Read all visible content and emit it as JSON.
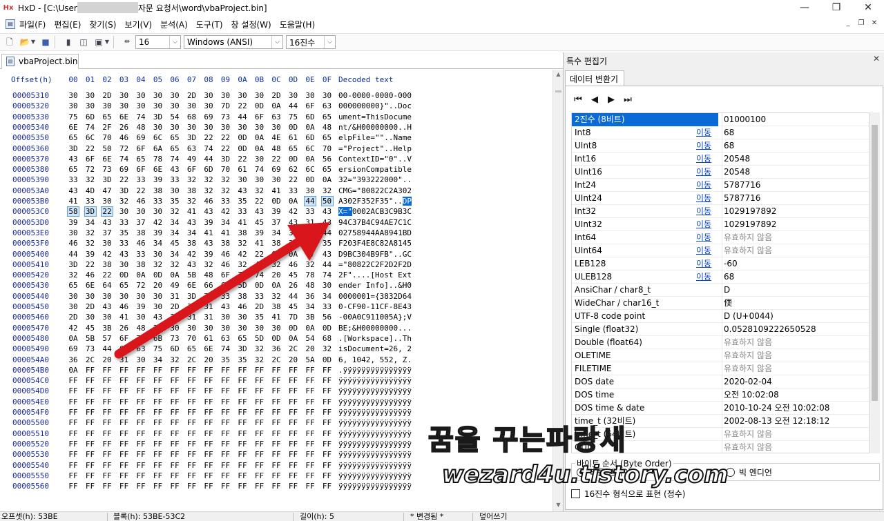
{
  "window": {
    "logo": "Hx",
    "title_prefix": "HxD - [C:\\User",
    "title_suffix": "자문 요청서\\word\\vbaProject.bin]",
    "minimize": "—",
    "restore": "❐",
    "close": "✕"
  },
  "menu": {
    "items": [
      "파일(F)",
      "편집(E)",
      "찾기(S)",
      "보기(V)",
      "분석(A)",
      "도구(T)",
      "창 설정(W)",
      "도움말(H)"
    ],
    "mdi": [
      "_",
      "❐",
      "✕"
    ]
  },
  "toolbar": {
    "bytes_per_row": "16",
    "charset": "Windows (ANSI)",
    "base": "16진수"
  },
  "document_tab": "vbaProject.bin",
  "hex": {
    "offset_header": "Offset(h)",
    "columns": [
      "00",
      "01",
      "02",
      "03",
      "04",
      "05",
      "06",
      "07",
      "08",
      "09",
      "0A",
      "0B",
      "0C",
      "0D",
      "0E",
      "0F"
    ],
    "decoded_header": "Decoded text",
    "rows": [
      {
        "offset": "00005310",
        "bytes": [
          "30",
          "30",
          "2D",
          "30",
          "30",
          "30",
          "30",
          "2D",
          "30",
          "30",
          "30",
          "30",
          "2D",
          "30",
          "30",
          "30"
        ],
        "text": "00-0000-0000-000"
      },
      {
        "offset": "00005320",
        "bytes": [
          "30",
          "30",
          "30",
          "30",
          "30",
          "30",
          "30",
          "30",
          "30",
          "7D",
          "22",
          "0D",
          "0A",
          "44",
          "6F",
          "63"
        ],
        "text": "000000000}\"..Doc"
      },
      {
        "offset": "00005330",
        "bytes": [
          "75",
          "6D",
          "65",
          "6E",
          "74",
          "3D",
          "54",
          "68",
          "69",
          "73",
          "44",
          "6F",
          "63",
          "75",
          "6D",
          "65"
        ],
        "text": "ument=ThisDocume"
      },
      {
        "offset": "00005340",
        "bytes": [
          "6E",
          "74",
          "2F",
          "26",
          "48",
          "30",
          "30",
          "30",
          "30",
          "30",
          "30",
          "30",
          "30",
          "0D",
          "0A",
          "48"
        ],
        "text": "nt/&H00000000..H"
      },
      {
        "offset": "00005350",
        "bytes": [
          "65",
          "6C",
          "70",
          "46",
          "69",
          "6C",
          "65",
          "3D",
          "22",
          "22",
          "0D",
          "0A",
          "4E",
          "61",
          "6D",
          "65"
        ],
        "text": "elpFile=\"\"..Name"
      },
      {
        "offset": "00005360",
        "bytes": [
          "3D",
          "22",
          "50",
          "72",
          "6F",
          "6A",
          "65",
          "63",
          "74",
          "22",
          "0D",
          "0A",
          "48",
          "65",
          "6C",
          "70"
        ],
        "text": "=\"Project\"..Help"
      },
      {
        "offset": "00005370",
        "bytes": [
          "43",
          "6F",
          "6E",
          "74",
          "65",
          "78",
          "74",
          "49",
          "44",
          "3D",
          "22",
          "30",
          "22",
          "0D",
          "0A",
          "56"
        ],
        "text": "ContextID=\"0\"..V"
      },
      {
        "offset": "00005380",
        "bytes": [
          "65",
          "72",
          "73",
          "69",
          "6F",
          "6E",
          "43",
          "6F",
          "6D",
          "70",
          "61",
          "74",
          "69",
          "62",
          "6C",
          "65"
        ],
        "text": "ersionCompatible"
      },
      {
        "offset": "00005390",
        "bytes": [
          "33",
          "32",
          "3D",
          "22",
          "33",
          "39",
          "33",
          "32",
          "32",
          "32",
          "30",
          "30",
          "30",
          "22",
          "0D",
          "0A"
        ],
        "text": "32=\"393222000\".."
      },
      {
        "offset": "000053A0",
        "bytes": [
          "43",
          "4D",
          "47",
          "3D",
          "22",
          "38",
          "30",
          "38",
          "32",
          "32",
          "43",
          "32",
          "41",
          "33",
          "30",
          "32"
        ],
        "text": "CMG=\"80822C2A302"
      },
      {
        "offset": "000053B0",
        "bytes": [
          "41",
          "33",
          "30",
          "32",
          "46",
          "33",
          "35",
          "32",
          "46",
          "33",
          "35",
          "22",
          "0D",
          "0A",
          "44",
          "50"
        ],
        "text": "A302F352F35\"..DP"
      },
      {
        "offset": "000053C0",
        "bytes": [
          "58",
          "3D",
          "22",
          "30",
          "30",
          "30",
          "32",
          "41",
          "43",
          "42",
          "33",
          "43",
          "39",
          "42",
          "33",
          "43"
        ],
        "text": "X=\"0002ACB3C9B3C"
      },
      {
        "offset": "000053D0",
        "bytes": [
          "39",
          "34",
          "43",
          "33",
          "37",
          "42",
          "34",
          "43",
          "39",
          "34",
          "41",
          "45",
          "37",
          "43",
          "31",
          "43"
        ],
        "text": "94C37B4C94AE7C1C"
      },
      {
        "offset": "000053E0",
        "bytes": [
          "30",
          "32",
          "37",
          "35",
          "38",
          "39",
          "34",
          "34",
          "41",
          "41",
          "38",
          "39",
          "34",
          "31",
          "42",
          "44"
        ],
        "text": "02758944AA8941BD"
      },
      {
        "offset": "000053F0",
        "bytes": [
          "46",
          "32",
          "30",
          "33",
          "46",
          "34",
          "45",
          "38",
          "43",
          "38",
          "32",
          "41",
          "38",
          "31",
          "34",
          "35"
        ],
        "text": "F203F4E8C82A8145"
      },
      {
        "offset": "00005400",
        "bytes": [
          "44",
          "39",
          "42",
          "43",
          "33",
          "30",
          "34",
          "42",
          "39",
          "46",
          "42",
          "22",
          "0D",
          "0A",
          "47",
          "43"
        ],
        "text": "D9BC304B9FB\"..GC"
      },
      {
        "offset": "00005410",
        "bytes": [
          "3D",
          "22",
          "38",
          "30",
          "38",
          "32",
          "32",
          "43",
          "32",
          "46",
          "32",
          "44",
          "32",
          "46",
          "32",
          "44"
        ],
        "text": "=\"80822C2F2D2F2D"
      },
      {
        "offset": "00005420",
        "bytes": [
          "32",
          "46",
          "22",
          "0D",
          "0A",
          "0D",
          "0A",
          "5B",
          "48",
          "6F",
          "73",
          "74",
          "20",
          "45",
          "78",
          "74"
        ],
        "text": "2F\"....[Host Ext"
      },
      {
        "offset": "00005430",
        "bytes": [
          "65",
          "6E",
          "64",
          "65",
          "72",
          "20",
          "49",
          "6E",
          "66",
          "6F",
          "5D",
          "0D",
          "0A",
          "26",
          "48",
          "30"
        ],
        "text": "ender Info]..&H0"
      },
      {
        "offset": "00005440",
        "bytes": [
          "30",
          "30",
          "30",
          "30",
          "30",
          "30",
          "31",
          "3D",
          "7B",
          "33",
          "38",
          "33",
          "32",
          "44",
          "36",
          "34"
        ],
        "text": "0000001={3832D64"
      },
      {
        "offset": "00005450",
        "bytes": [
          "30",
          "2D",
          "43",
          "46",
          "39",
          "30",
          "2D",
          "31",
          "31",
          "43",
          "46",
          "2D",
          "38",
          "45",
          "34",
          "33"
        ],
        "text": "0-CF90-11CF-8E43"
      },
      {
        "offset": "00005460",
        "bytes": [
          "2D",
          "30",
          "30",
          "41",
          "30",
          "43",
          "39",
          "31",
          "31",
          "30",
          "30",
          "35",
          "41",
          "7D",
          "3B",
          "56"
        ],
        "text": "-00A0C911005A};V"
      },
      {
        "offset": "00005470",
        "bytes": [
          "42",
          "45",
          "3B",
          "26",
          "48",
          "30",
          "30",
          "30",
          "30",
          "30",
          "30",
          "30",
          "30",
          "0D",
          "0A",
          "0D"
        ],
        "text": "BE;&H00000000..."
      },
      {
        "offset": "00005480",
        "bytes": [
          "0A",
          "5B",
          "57",
          "6F",
          "72",
          "6B",
          "73",
          "70",
          "61",
          "63",
          "65",
          "5D",
          "0D",
          "0A",
          "54",
          "68"
        ],
        "text": ".[Workspace]..Th"
      },
      {
        "offset": "00005490",
        "bytes": [
          "69",
          "73",
          "44",
          "6F",
          "63",
          "75",
          "6D",
          "65",
          "6E",
          "74",
          "3D",
          "32",
          "36",
          "2C",
          "20",
          "32"
        ],
        "text": "isDocument=26, 2"
      },
      {
        "offset": "000054A0",
        "bytes": [
          "36",
          "2C",
          "20",
          "31",
          "30",
          "34",
          "32",
          "2C",
          "20",
          "35",
          "35",
          "32",
          "2C",
          "20",
          "5A",
          "0D"
        ],
        "text": "6, 1042, 552, Z."
      },
      {
        "offset": "000054B0",
        "bytes": [
          "0A",
          "FF",
          "FF",
          "FF",
          "FF",
          "FF",
          "FF",
          "FF",
          "FF",
          "FF",
          "FF",
          "FF",
          "FF",
          "FF",
          "FF",
          "FF"
        ],
        "text": ".ÿÿÿÿÿÿÿÿÿÿÿÿÿÿÿ"
      },
      {
        "offset": "000054C0",
        "bytes": [
          "FF",
          "FF",
          "FF",
          "FF",
          "FF",
          "FF",
          "FF",
          "FF",
          "FF",
          "FF",
          "FF",
          "FF",
          "FF",
          "FF",
          "FF",
          "FF"
        ],
        "text": "ÿÿÿÿÿÿÿÿÿÿÿÿÿÿÿÿ"
      },
      {
        "offset": "000054D0",
        "bytes": [
          "FF",
          "FF",
          "FF",
          "FF",
          "FF",
          "FF",
          "FF",
          "FF",
          "FF",
          "FF",
          "FF",
          "FF",
          "FF",
          "FF",
          "FF",
          "FF"
        ],
        "text": "ÿÿÿÿÿÿÿÿÿÿÿÿÿÿÿÿ"
      },
      {
        "offset": "000054E0",
        "bytes": [
          "FF",
          "FF",
          "FF",
          "FF",
          "FF",
          "FF",
          "FF",
          "FF",
          "FF",
          "FF",
          "FF",
          "FF",
          "FF",
          "FF",
          "FF",
          "FF"
        ],
        "text": "ÿÿÿÿÿÿÿÿÿÿÿÿÿÿÿÿ"
      },
      {
        "offset": "000054F0",
        "bytes": [
          "FF",
          "FF",
          "FF",
          "FF",
          "FF",
          "FF",
          "FF",
          "FF",
          "FF",
          "FF",
          "FF",
          "FF",
          "FF",
          "FF",
          "FF",
          "FF"
        ],
        "text": "ÿÿÿÿÿÿÿÿÿÿÿÿÿÿÿÿ"
      },
      {
        "offset": "00005500",
        "bytes": [
          "FF",
          "FF",
          "FF",
          "FF",
          "FF",
          "FF",
          "FF",
          "FF",
          "FF",
          "FF",
          "FF",
          "FF",
          "FF",
          "FF",
          "FF",
          "FF"
        ],
        "text": "ÿÿÿÿÿÿÿÿÿÿÿÿÿÿÿÿ"
      },
      {
        "offset": "00005510",
        "bytes": [
          "FF",
          "FF",
          "FF",
          "FF",
          "FF",
          "FF",
          "FF",
          "FF",
          "FF",
          "FF",
          "FF",
          "FF",
          "FF",
          "FF",
          "FF",
          "FF"
        ],
        "text": "ÿÿÿÿÿÿÿÿÿÿÿÿÿÿÿÿ"
      },
      {
        "offset": "00005520",
        "bytes": [
          "FF",
          "FF",
          "FF",
          "FF",
          "FF",
          "FF",
          "FF",
          "FF",
          "FF",
          "FF",
          "FF",
          "FF",
          "FF",
          "FF",
          "FF",
          "FF"
        ],
        "text": "ÿÿÿÿÿÿÿÿÿÿÿÿÿÿÿÿ"
      },
      {
        "offset": "00005530",
        "bytes": [
          "FF",
          "FF",
          "FF",
          "FF",
          "FF",
          "FF",
          "FF",
          "FF",
          "FF",
          "FF",
          "FF",
          "FF",
          "FF",
          "FF",
          "FF",
          "FF"
        ],
        "text": "ÿÿÿÿÿÿÿÿÿÿÿÿÿÿÿÿ"
      },
      {
        "offset": "00005540",
        "bytes": [
          "FF",
          "FF",
          "FF",
          "FF",
          "FF",
          "FF",
          "FF",
          "FF",
          "FF",
          "FF",
          "FF",
          "FF",
          "FF",
          "FF",
          "FF",
          "FF"
        ],
        "text": "ÿÿÿÿÿÿÿÿÿÿÿÿÿÿÿÿ"
      },
      {
        "offset": "00005550",
        "bytes": [
          "FF",
          "FF",
          "FF",
          "FF",
          "FF",
          "FF",
          "FF",
          "FF",
          "FF",
          "FF",
          "FF",
          "FF",
          "FF",
          "FF",
          "FF",
          "FF"
        ],
        "text": "ÿÿÿÿÿÿÿÿÿÿÿÿÿÿÿÿ"
      },
      {
        "offset": "00005560",
        "bytes": [
          "FF",
          "FF",
          "FF",
          "FF",
          "FF",
          "FF",
          "FF",
          "FF",
          "FF",
          "FF",
          "FF",
          "FF",
          "FF",
          "FF",
          "FF",
          "FF"
        ],
        "text": "ÿÿÿÿÿÿÿÿÿÿÿÿÿÿÿÿ"
      }
    ],
    "selection": "53BE-53C2"
  },
  "inspector": {
    "pane_title": "특수 편집기",
    "close": "✕",
    "tab": "데이터 변환기",
    "nav": [
      "⏮",
      "◀",
      "▶",
      "⏭"
    ],
    "link_label": "이동",
    "rows": [
      {
        "name": "2진수 (8비트)",
        "value": "01000100",
        "link": false,
        "gray": false
      },
      {
        "name": "Int8",
        "value": "68",
        "link": true,
        "gray": false
      },
      {
        "name": "UInt8",
        "value": "68",
        "link": true,
        "gray": false
      },
      {
        "name": "Int16",
        "value": "20548",
        "link": true,
        "gray": false
      },
      {
        "name": "UInt16",
        "value": "20548",
        "link": true,
        "gray": false
      },
      {
        "name": "Int24",
        "value": "5787716",
        "link": true,
        "gray": false
      },
      {
        "name": "UInt24",
        "value": "5787716",
        "link": true,
        "gray": false
      },
      {
        "name": "Int32",
        "value": "1029197892",
        "link": true,
        "gray": false
      },
      {
        "name": "UInt32",
        "value": "1029197892",
        "link": true,
        "gray": false
      },
      {
        "name": "Int64",
        "value": "유효하지 않음",
        "link": true,
        "gray": true
      },
      {
        "name": "UInt64",
        "value": "유효하지 않음",
        "link": true,
        "gray": true
      },
      {
        "name": "LEB128",
        "value": "-60",
        "link": true,
        "gray": false
      },
      {
        "name": "ULEB128",
        "value": "68",
        "link": true,
        "gray": false
      },
      {
        "name": "AnsiChar / char8_t",
        "value": "D",
        "link": false,
        "gray": false
      },
      {
        "name": "WideChar / char16_t",
        "value": "偄",
        "link": false,
        "gray": false
      },
      {
        "name": "UTF-8 code point",
        "value": "D (U+0044)",
        "link": false,
        "gray": false
      },
      {
        "name": "Single (float32)",
        "value": "0.0528109222650528",
        "link": false,
        "gray": false
      },
      {
        "name": "Double (float64)",
        "value": "유효하지 않음",
        "link": false,
        "gray": true
      },
      {
        "name": "OLETIME",
        "value": "유효하지 않음",
        "link": false,
        "gray": true
      },
      {
        "name": "FILETIME",
        "value": "유효하지 않음",
        "link": false,
        "gray": true
      },
      {
        "name": "DOS date",
        "value": "2020-02-04",
        "link": false,
        "gray": false
      },
      {
        "name": "DOS time",
        "value": "오전 10:02:08",
        "link": false,
        "gray": false
      },
      {
        "name": "DOS time & date",
        "value": "2010-10-24 오전 10:02:08",
        "link": false,
        "gray": false
      },
      {
        "name": "time_t (32비트)",
        "value": "2002-08-13 오전 12:18:12",
        "link": false,
        "gray": false
      },
      {
        "name": "time_t (64비트)",
        "value": "유효하지 않음",
        "link": false,
        "gray": true
      },
      {
        "name": "GUID",
        "value": "유효하지 않음",
        "link": false,
        "gray": true
      }
    ],
    "byte_order_label": "바이트 순서 (Byte Order)",
    "little_endian": "리틀 엔디언",
    "big_endian": "빅 엔디언",
    "hex_checkbox": "16진수 형식으로 표현 (정수)"
  },
  "status": {
    "offset": "오프셋(h): 53BE",
    "block": "블록(h): 53BE-53C2",
    "length": "길이(h): 5",
    "changed": "* 변경됨 *",
    "mode": "덮어쓰기"
  },
  "watermark": {
    "title": "꿈을 꾸는파랑새",
    "site": "wezard4u.tistory.com"
  },
  "colors": {
    "offset_blue": "#1a2c9a",
    "header_blue": "#0b2fa0",
    "selection_blue": "#0a6ad6",
    "arrow_red": "#d8141a"
  }
}
